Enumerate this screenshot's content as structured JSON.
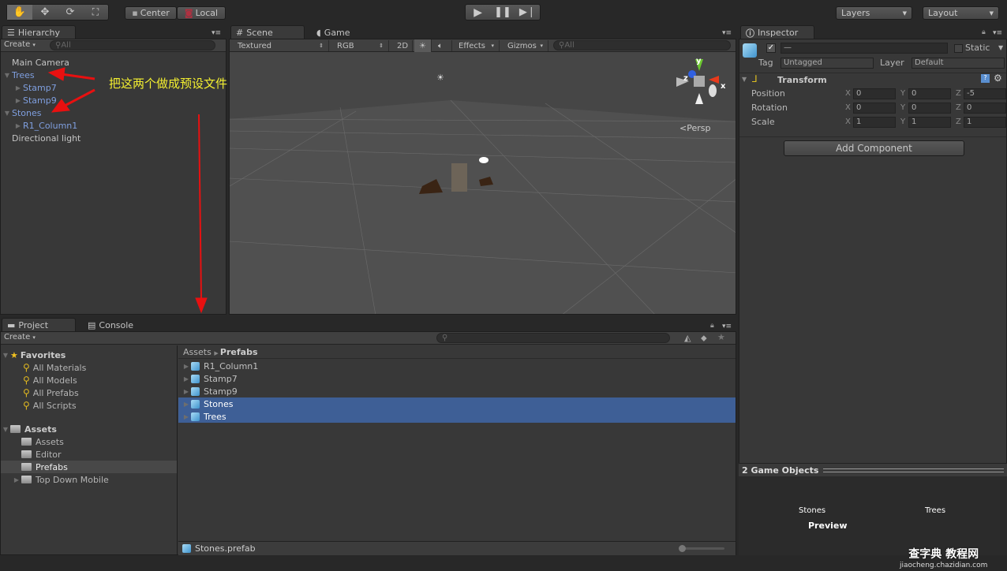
{
  "toolbar": {
    "tools": [
      "hand-tool",
      "move-tool",
      "rotate-tool",
      "scale-tool"
    ],
    "pivot": "Center",
    "space": "Local",
    "play": [
      "play",
      "pause",
      "step"
    ],
    "layers": "Layers",
    "layout": "Layout"
  },
  "hierarchy": {
    "tab": "Hierarchy",
    "create": "Create",
    "search": "All",
    "items": [
      {
        "label": "Main Camera",
        "depth": 0,
        "expander": "none",
        "color": "normal"
      },
      {
        "label": "Trees",
        "depth": 0,
        "expander": "open",
        "color": "blue"
      },
      {
        "label": "Stamp7",
        "depth": 1,
        "expander": "closed",
        "color": "blue"
      },
      {
        "label": "Stamp9",
        "depth": 1,
        "expander": "closed",
        "color": "blue"
      },
      {
        "label": "Stones",
        "depth": 0,
        "expander": "open",
        "color": "blue"
      },
      {
        "label": "R1_Column1",
        "depth": 1,
        "expander": "closed",
        "color": "blue"
      },
      {
        "label": "Directional light",
        "depth": 0,
        "expander": "none",
        "color": "normal"
      }
    ],
    "annotation": "把这两个做成预设文件"
  },
  "scene": {
    "tabs": [
      "Scene",
      "Game"
    ],
    "shading": "Textured",
    "render": "RGB",
    "mode2d": "2D",
    "effects": "Effects",
    "gizmos": "Gizmos",
    "search": "All",
    "gizmo_axes": {
      "y": "y",
      "x": "x",
      "z": "z"
    },
    "projection": "Persp"
  },
  "inspector": {
    "tab": "Inspector",
    "name": "—",
    "static": "Static",
    "tag_label": "Tag",
    "tag": "Untagged",
    "layer_label": "Layer",
    "layer": "Default",
    "component": "Transform",
    "rows": [
      {
        "label": "Position",
        "x": "0",
        "y": "0",
        "z": "-5"
      },
      {
        "label": "Rotation",
        "x": "0",
        "y": "0",
        "z": "0"
      },
      {
        "label": "Scale",
        "x": "1",
        "y": "1",
        "z": "1"
      }
    ],
    "add_component": "Add Component",
    "preview_title": "2 Game Objects",
    "preview_items": [
      "Stones",
      "Trees"
    ],
    "preview_label": "Preview"
  },
  "project": {
    "tabs": [
      "Project",
      "Console"
    ],
    "create": "Create",
    "favorites_label": "Favorites",
    "favorites": [
      "All Materials",
      "All Models",
      "All Prefabs",
      "All Scripts"
    ],
    "assets_label": "Assets",
    "folders": [
      "Assets",
      "Editor",
      "Prefabs",
      "Top Down Mobile"
    ],
    "selected_folder": "Prefabs",
    "breadcrumb": [
      "Assets",
      "Prefabs"
    ],
    "files": [
      {
        "name": "R1_Column1",
        "selected": false
      },
      {
        "name": "Stamp7",
        "selected": false
      },
      {
        "name": "Stamp9",
        "selected": false
      },
      {
        "name": "Stones",
        "selected": true
      },
      {
        "name": "Trees",
        "selected": true
      }
    ],
    "status_file": "Stones.prefab"
  },
  "watermark": {
    "site": "查字典 教程网",
    "url": "jiaocheng.chazidian.com"
  }
}
